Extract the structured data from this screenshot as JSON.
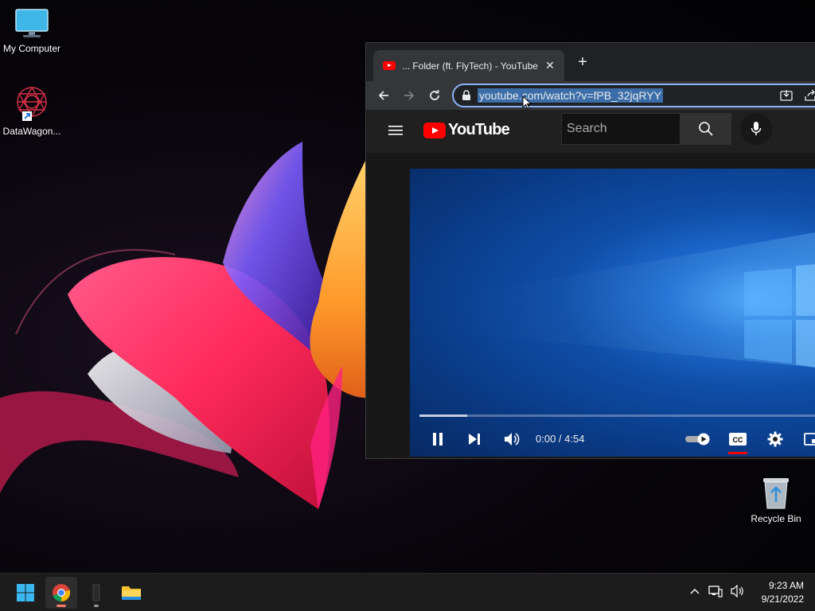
{
  "desktop": {
    "icons": [
      {
        "label": "My Computer"
      },
      {
        "label": "DataWagon..."
      },
      {
        "label": "Recycle Bin"
      }
    ]
  },
  "browser": {
    "tab_title": "... Folder (ft. FlyTech) - YouTube",
    "tab_close": "✕",
    "new_tab": "+",
    "url": "youtube.com/watch?v=fPB_32jqRYY"
  },
  "youtube": {
    "wordmark": "YouTube",
    "search_placeholder": "Search",
    "player": {
      "current_time": "0:00",
      "duration": "4:54",
      "time_display": "0:00 / 4:54",
      "progress_fraction": 0.12,
      "cc_label": "CC"
    }
  },
  "taskbar": {
    "apps": [
      "start-icon",
      "chrome-icon",
      "usb-app-icon",
      "file-explorer-icon"
    ],
    "clock": {
      "time": "9:23 AM",
      "date": "9/21/2022"
    }
  },
  "colors": {
    "accent": "#8ab4f8",
    "youtube_red": "#ff0000",
    "chrome_tab": "#35363a",
    "taskbar": "#1c1c1c"
  }
}
